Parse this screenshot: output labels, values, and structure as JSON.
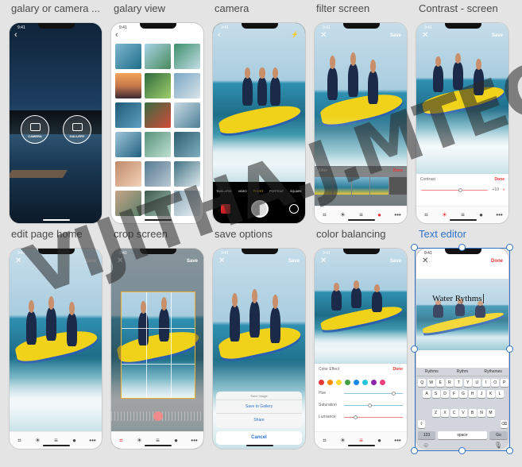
{
  "captions": [
    "galary or camera ...",
    "galary view",
    "camera",
    "filter screen",
    "Contrast - screen",
    "edit page home",
    "crop screen",
    "save options",
    "color balancing",
    "Text editor"
  ],
  "status_time": "9:41",
  "camera_home": {
    "camera_label": "CAMERA",
    "gallery_label": "GALLERY"
  },
  "camera": {
    "modes": [
      "TIMELAPSE",
      "VIDEO",
      "PHOTO",
      "PORTRAIT",
      "SQUARE"
    ],
    "active_mode": "PHOTO"
  },
  "header": {
    "save": "Save",
    "done": "Done",
    "close": "✕",
    "back": "‹"
  },
  "filter": {
    "title": "Filter",
    "done": "Done"
  },
  "contrast": {
    "title": "Contrast",
    "done": "Done",
    "value": "+10",
    "level": 0.6
  },
  "save_options": {
    "title": "Save Image",
    "save_gallery": "Save to Gallery",
    "share": "Share",
    "cancel": "Cancel"
  },
  "color_effect": {
    "title": "Color Effect",
    "done": "Done",
    "colors": [
      "#e53935",
      "#fb8c00",
      "#fdd835",
      "#43a047",
      "#1e88e5",
      "#26c6da",
      "#8e24aa",
      "#ec407a"
    ],
    "sliders": [
      {
        "label": "Hue",
        "level": 0.85
      },
      {
        "label": "Saturation",
        "level": 0.45
      },
      {
        "label": "Lumiance",
        "level": 0.2
      }
    ]
  },
  "text_editor": {
    "done": "Done",
    "text": "Water Rythms",
    "suggestions": [
      "Rythms",
      "Rythm",
      "Rythemes"
    ],
    "rows": [
      [
        "Q",
        "W",
        "E",
        "R",
        "T",
        "Y",
        "U",
        "I",
        "O",
        "P"
      ],
      [
        "A",
        "S",
        "D",
        "F",
        "G",
        "H",
        "J",
        "K",
        "L"
      ],
      [
        "Z",
        "X",
        "C",
        "V",
        "B",
        "N",
        "M"
      ]
    ],
    "num": "123",
    "space": "space",
    "go": "Go"
  },
  "tools": [
    "crop-icon",
    "sun-icon",
    "sliders-icon",
    "circles-icon",
    "more-icon"
  ],
  "watermark": "VIJITHA.J.MTECH",
  "colors": {
    "accent": "#e33",
    "selection": "#2f73c9"
  }
}
